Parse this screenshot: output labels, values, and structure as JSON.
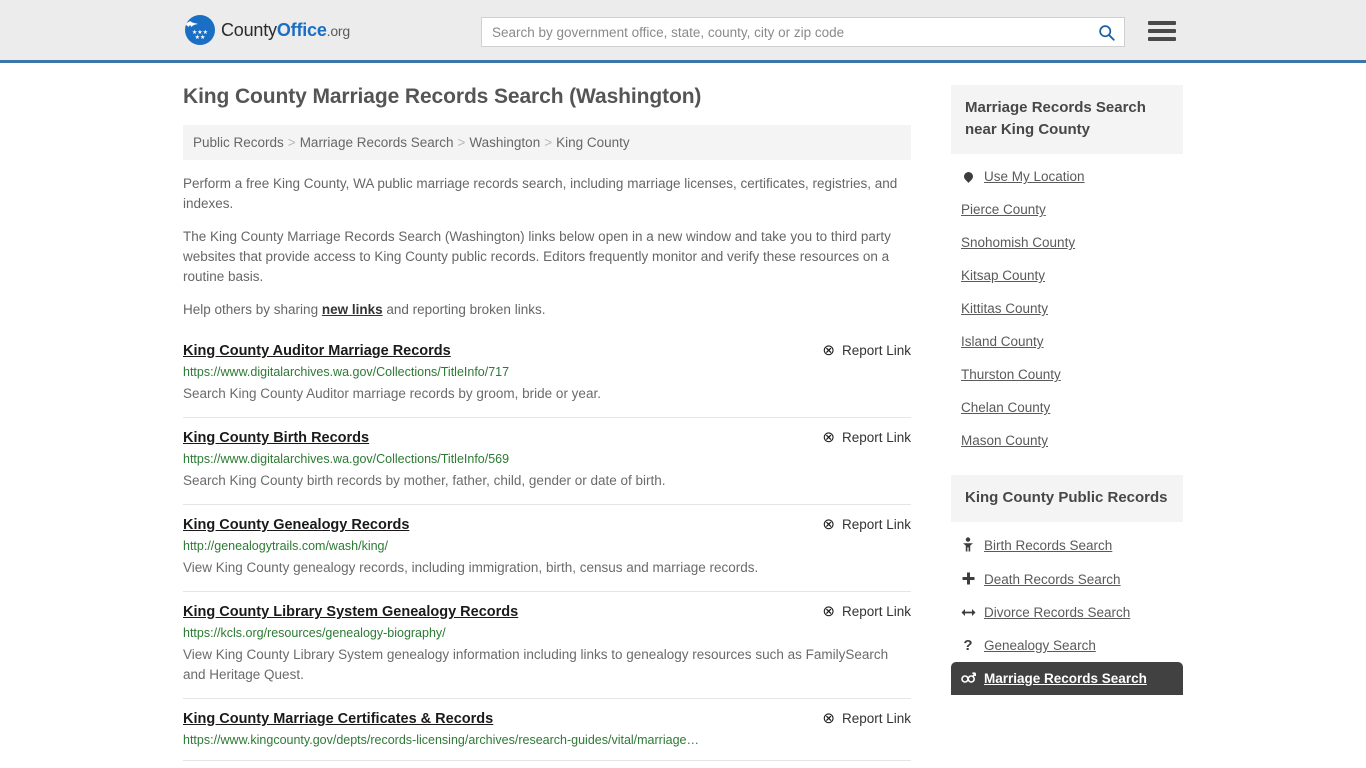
{
  "header": {
    "logo": {
      "name_part1": "County",
      "name_part2": "Office",
      "tld": ".org",
      "eagle_glyph": " ",
      "stars_top": "★★★",
      "stars_bottom": "★★"
    },
    "search": {
      "placeholder": "Search by government office, state, county, city or zip code",
      "value": "",
      "icon": "search-icon"
    },
    "menu_icon": "hamburger-menu-icon"
  },
  "page": {
    "title": "King County Marriage Records Search (Washington)",
    "breadcrumb": [
      {
        "label": "Public Records",
        "link": true
      },
      {
        "label": "Marriage Records Search",
        "link": true
      },
      {
        "label": "Washington",
        "link": true
      },
      {
        "label": "King County",
        "link": true
      }
    ],
    "breadcrumb_separator": ">",
    "intro": [
      "Perform a free King County, WA public marriage records search, including marriage licenses, certificates, registries, and indexes.",
      "The King County Marriage Records Search (Washington) links below open in a new window and take you to third party websites that provide access to King County public records. Editors frequently monitor and verify these resources on a routine basis."
    ],
    "help_line": {
      "before": "Help others by sharing ",
      "link": "new links",
      "after": " and reporting broken links."
    }
  },
  "results": {
    "report_label": "Report Link",
    "report_icon": "broken-link-icon",
    "items": [
      {
        "title": "King County Auditor Marriage Records",
        "url": "https://www.digitalarchives.wa.gov/Collections/TitleInfo/717",
        "description": "Search King County Auditor marriage records by groom, bride or year."
      },
      {
        "title": "King County Birth Records",
        "url": "https://www.digitalarchives.wa.gov/Collections/TitleInfo/569",
        "description": "Search King County birth records by mother, father, child, gender or date of birth."
      },
      {
        "title": "King County Genealogy Records",
        "url": "http://genealogytrails.com/wash/king/",
        "description": "View King County genealogy records, including immigration, birth, census and marriage records."
      },
      {
        "title": "King County Library System Genealogy Records",
        "url": "https://kcls.org/resources/genealogy-biography/",
        "description": "View King County Library System genealogy information including links to genealogy resources such as FamilySearch and Heritage Quest."
      },
      {
        "title": "King County Marriage Certificates & Records",
        "url": "https://www.kingcounty.gov/depts/records-licensing/archives/research-guides/vital/marriage…",
        "description": ""
      }
    ]
  },
  "sidebar": {
    "nearby": {
      "heading": "Marriage Records Search near King County",
      "items": [
        {
          "label": "Use My Location",
          "icon": "location-pin-icon",
          "has_icon": true
        },
        {
          "label": "Pierce County",
          "icon": "",
          "has_icon": false
        },
        {
          "label": "Snohomish County",
          "icon": "",
          "has_icon": false
        },
        {
          "label": "Kitsap County",
          "icon": "",
          "has_icon": false
        },
        {
          "label": "Kittitas County",
          "icon": "",
          "has_icon": false
        },
        {
          "label": "Island County",
          "icon": "",
          "has_icon": false
        },
        {
          "label": "Thurston County",
          "icon": "",
          "has_icon": false
        },
        {
          "label": "Chelan County",
          "icon": "",
          "has_icon": false
        },
        {
          "label": "Mason County",
          "icon": "",
          "has_icon": false
        }
      ]
    },
    "public_records": {
      "heading": "King County Public Records",
      "items": [
        {
          "label": "Birth Records Search",
          "icon": "baby-icon",
          "glyph": "ὫC",
          "active": false
        },
        {
          "label": "Death Records Search",
          "icon": "cross-icon",
          "glyph": "✚",
          "active": false
        },
        {
          "label": "Divorce Records Search",
          "icon": "left-right-arrow-icon",
          "glyph": "↔",
          "active": false
        },
        {
          "label": "Genealogy Search",
          "icon": "question-mark-icon",
          "glyph": "?",
          "active": false
        },
        {
          "label": "Marriage Records Search",
          "icon": "male-female-icon",
          "glyph": "⚥",
          "active": true
        }
      ]
    }
  },
  "colors": {
    "header_bg": "#ececec",
    "header_border": "#3c76a8",
    "brand_blue": "#1a6fc4",
    "url_green": "#2c7a33",
    "panel_gray": "#f4f4f4",
    "active_dark": "#414141"
  }
}
